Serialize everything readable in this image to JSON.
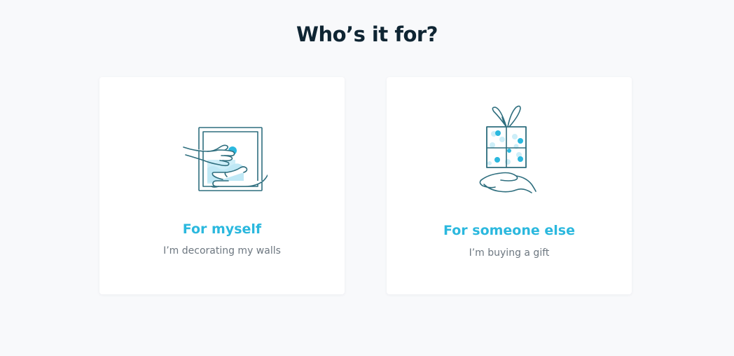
{
  "heading": "Who’s it for?",
  "options": [
    {
      "label": "For myself",
      "subtitle": "I’m decorating my walls",
      "icon": "hands-hanging-frame-icon"
    },
    {
      "label": "For someone else",
      "subtitle": "I’m buying a gift",
      "icon": "hand-holding-gift-icon"
    }
  ],
  "colors": {
    "background": "#f8f9fb",
    "heading": "#0f2533",
    "accent": "#2bb8de",
    "subtitle": "#6d7780",
    "line_art": "#2e6e7e"
  }
}
